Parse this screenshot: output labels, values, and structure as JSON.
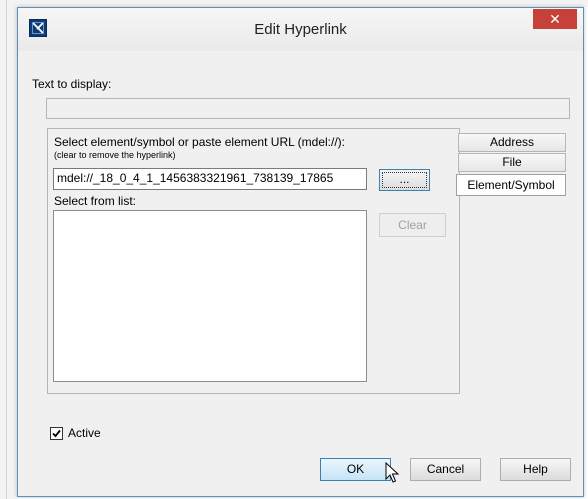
{
  "window": {
    "title": "Edit Hyperlink",
    "close_glyph": "✕"
  },
  "text_to_display": {
    "label": "Text to display:",
    "value": ""
  },
  "tabs": [
    {
      "label": "Address",
      "selected": false
    },
    {
      "label": "File",
      "selected": false
    },
    {
      "label": "Element/Symbol",
      "selected": true
    }
  ],
  "element_panel": {
    "instruction": "Select element/symbol or paste element URL (mdel://):",
    "hint": "(clear to remove the hyperlink)",
    "url_value": "mdel://_18_0_4_1_1456383321961_738139_17865",
    "browse_label": "...",
    "list_label": "Select from list:",
    "clear_label": "Clear"
  },
  "active": {
    "label": "Active",
    "checked": true
  },
  "buttons": {
    "ok": "OK",
    "cancel": "Cancel",
    "help": "Help"
  },
  "icons": {
    "app": "app-logo-icon",
    "close": "close-icon",
    "check": "checkmark-icon",
    "cursor": "mouse-pointer-icon"
  },
  "colors": {
    "close_button": "#c6413a",
    "window_border": "#5c90b8",
    "dialog_bg": "#f0f0f0"
  }
}
